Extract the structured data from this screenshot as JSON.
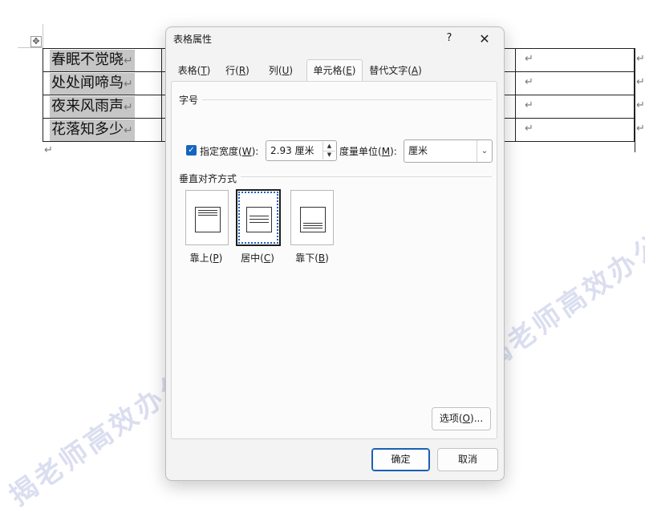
{
  "document": {
    "rows": [
      "春眠不觉晓",
      "处处闻啼鸟",
      "夜来风雨声",
      "花落知多少"
    ],
    "paragraph_mark": "↵"
  },
  "watermark": {
    "text": "揭老师高效办公"
  },
  "dialog": {
    "title": "表格属性",
    "help_label": "?",
    "close_label": "✕",
    "tabs": [
      {
        "label": "表格",
        "key": "T"
      },
      {
        "label": "行",
        "key": "R"
      },
      {
        "label": "列",
        "key": "U"
      },
      {
        "label": "单元格",
        "key": "E"
      },
      {
        "label": "替代文字",
        "key": "A"
      }
    ],
    "size_section": "字号",
    "preferred_width": {
      "label": "指定宽度",
      "key": "W",
      "checked": true,
      "value": "2.93 厘米"
    },
    "measure_in": {
      "label": "度量单位",
      "key": "M",
      "value": "厘米"
    },
    "valign_section": "垂直对齐方式",
    "valign_options": [
      {
        "label": "靠上",
        "key": "P"
      },
      {
        "label": "居中",
        "key": "C"
      },
      {
        "label": "靠下",
        "key": "B"
      }
    ],
    "selected_valign": "居中",
    "options_button": {
      "label": "选项",
      "key": "O",
      "suffix": "..."
    },
    "ok_label": "确定",
    "cancel_label": "取消"
  },
  "colors": {
    "accent": "#1565c0",
    "cell_highlight": "#c6c6c6",
    "watermark": "#96a0d2"
  }
}
